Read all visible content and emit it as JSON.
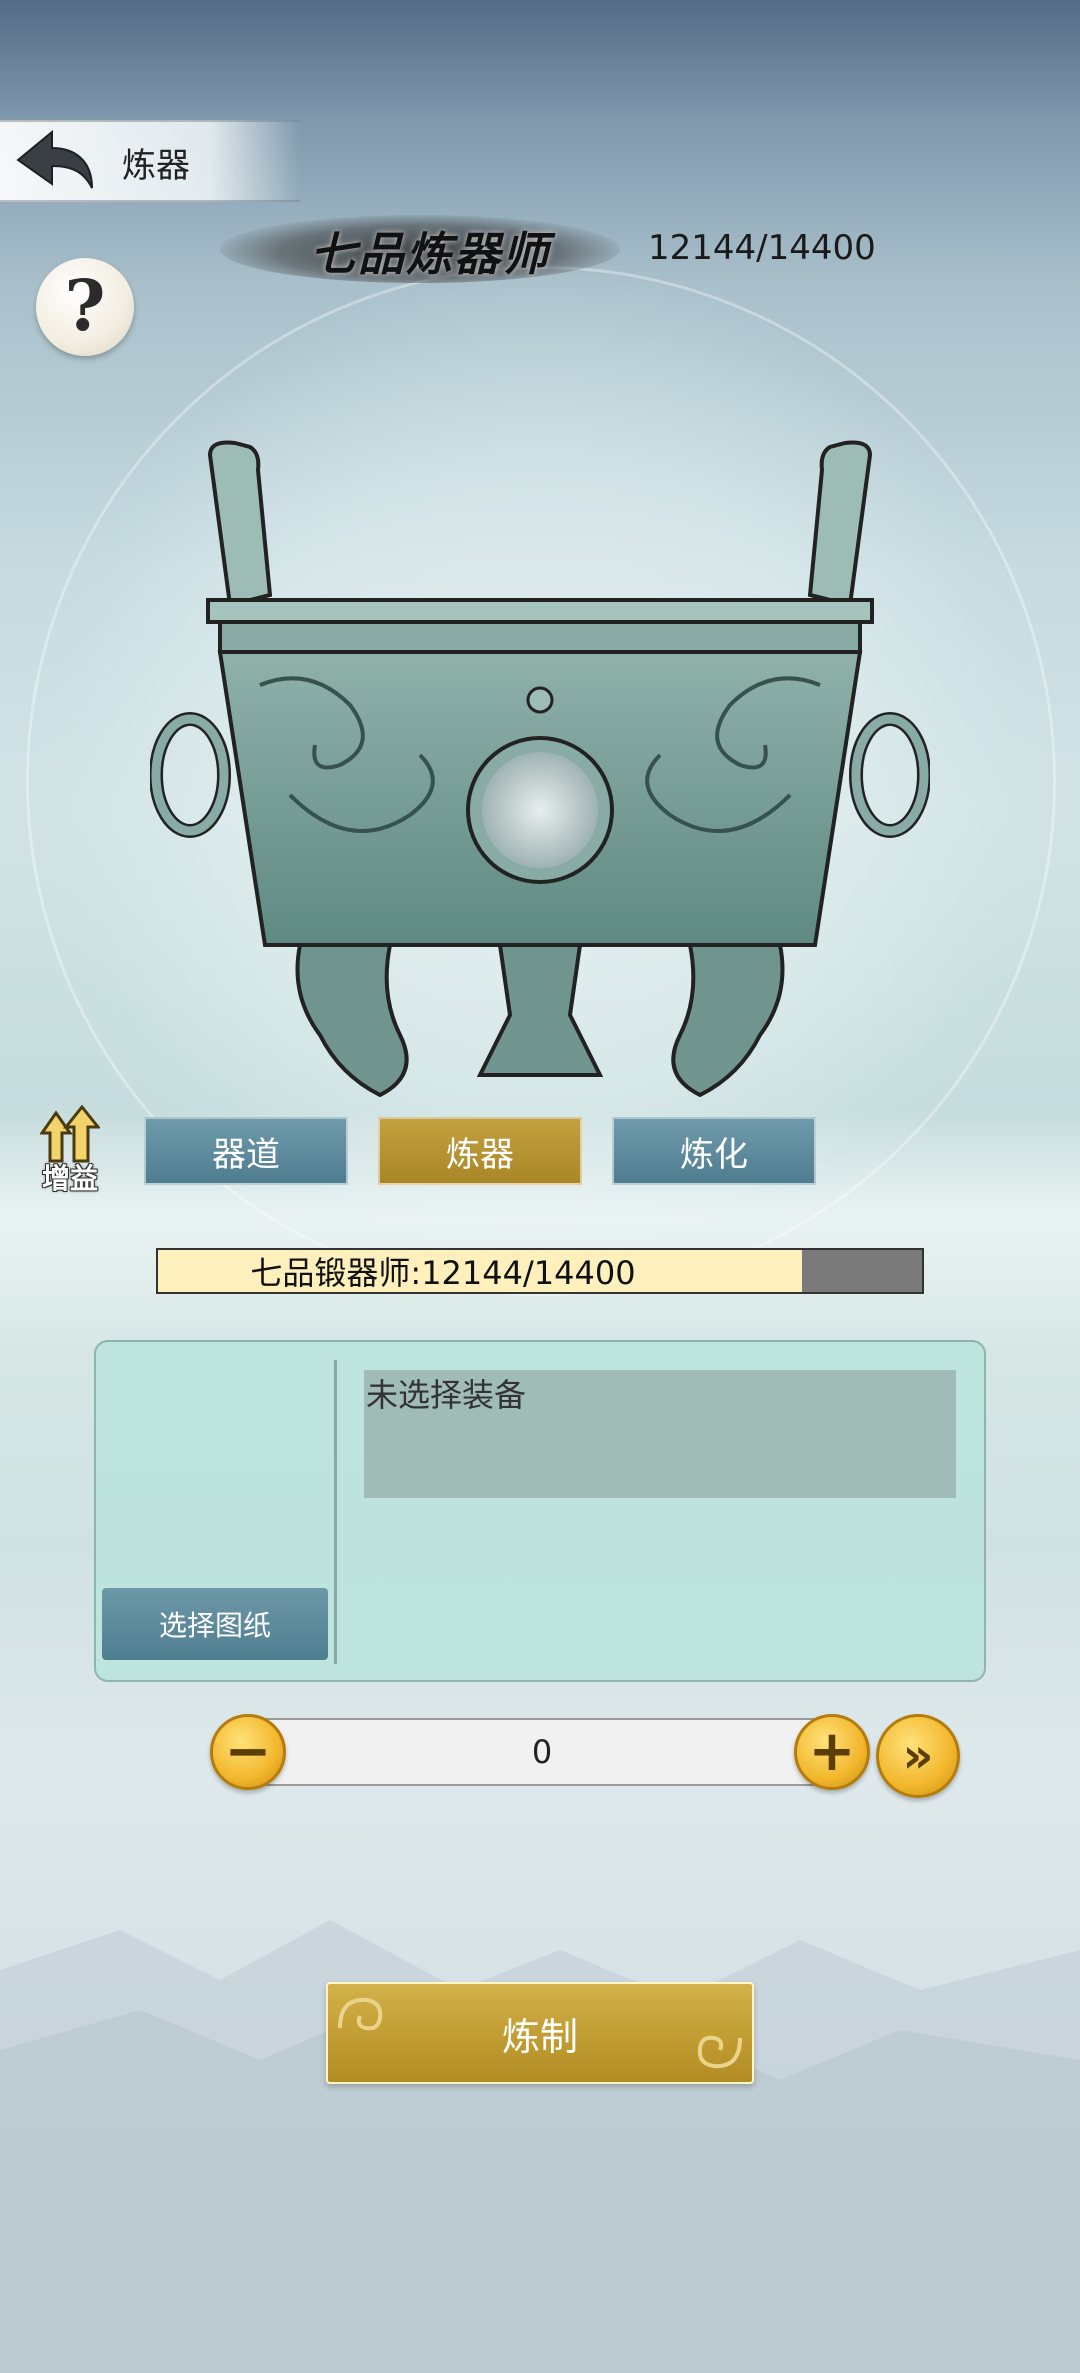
{
  "header": {
    "title": "炼器",
    "rank_title": "七品炼器师",
    "rank_progress": "12144/14400"
  },
  "icons": {
    "back": "back-arrow-icon",
    "help": "question-mark-icon",
    "buff": "buff-up-arrows-icon",
    "cauldron": "bronze-cauldron-illustration",
    "minus": "minus-icon",
    "plus": "plus-icon",
    "max": "double-chevron-right-icon"
  },
  "buff": {
    "label": "增益"
  },
  "tabs": [
    {
      "label": "器道",
      "active": false
    },
    {
      "label": "炼器",
      "active": true
    },
    {
      "label": "炼化",
      "active": false
    }
  ],
  "progress": {
    "text": "七品锻器师:12144/14400",
    "current": 12144,
    "max": 14400
  },
  "panel": {
    "select_button": "选择图纸",
    "equipment_text": "未选择装备"
  },
  "quantity": {
    "value": "0",
    "minus_symbol": "−",
    "plus_symbol": "+",
    "max_symbol": "»"
  },
  "craft_button": "炼制",
  "colors": {
    "tab_active": "#c4a13f",
    "tab_normal": "#5e8b9e",
    "progress_fill": "#fdf0bd",
    "progress_track": "#7a7a7a",
    "panel_bg": "#bae3dc",
    "gold_button": "#c29e34"
  }
}
